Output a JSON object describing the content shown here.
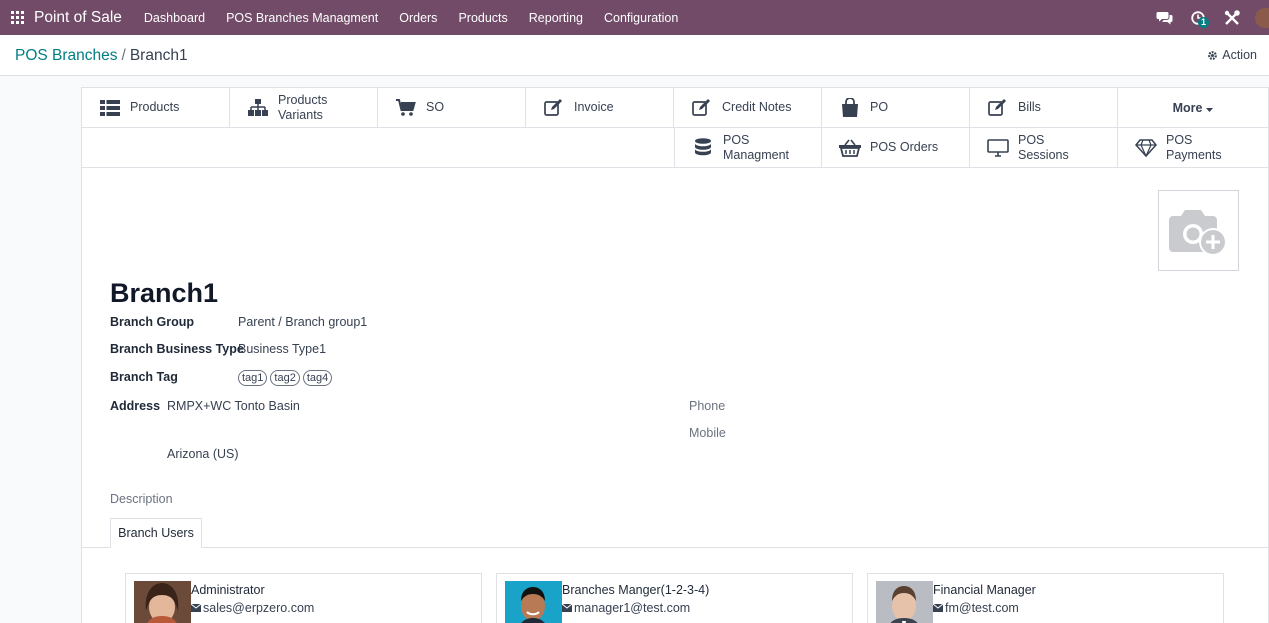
{
  "topnav": {
    "app_name": "Point of Sale",
    "menu": [
      "Dashboard",
      "POS Branches Managment",
      "Orders",
      "Products",
      "Reporting",
      "Configuration"
    ],
    "activity_count": "1",
    "bg_color": "#714b67"
  },
  "breadcrumb": {
    "parent": "POS Branches",
    "separator": "/",
    "current": "Branch1"
  },
  "action_label": "Action",
  "smart_buttons": [
    {
      "label": "Products",
      "icon": "list-icon"
    },
    {
      "label": "Products Variants",
      "icon": "sitemap-icon"
    },
    {
      "label": "SO",
      "icon": "cart-icon"
    },
    {
      "label": "Invoice",
      "icon": "edit-icon"
    },
    {
      "label": "Credit Notes",
      "icon": "edit-icon"
    },
    {
      "label": "PO",
      "icon": "shopping-bag-icon"
    },
    {
      "label": "Bills",
      "icon": "edit-icon"
    },
    {
      "label": "More",
      "icon": "caret-down-icon"
    },
    {
      "label": "POS Managment",
      "icon": "database-icon"
    },
    {
      "label": "POS Orders",
      "icon": "basket-icon"
    },
    {
      "label": "POS Sessions",
      "icon": "desktop-icon"
    },
    {
      "label": "POS Payments",
      "icon": "diamond-icon"
    }
  ],
  "record": {
    "name": "Branch1",
    "branch_group_label": "Branch Group",
    "branch_group": "Parent / Branch group1",
    "business_type_label": "Branch Business Type",
    "business_type": "Business Type1",
    "tag_label": "Branch Tag",
    "tags": [
      "tag1",
      "tag2",
      "tag4"
    ],
    "address_label": "Address",
    "address_line1": "RMPX+WC Tonto Basin",
    "address_line2": "Arizona (US)",
    "phone_label": "Phone",
    "mobile_label": "Mobile",
    "description_label": "Description"
  },
  "tabs": {
    "active": "Branch Users"
  },
  "users": [
    {
      "name": "Administrator",
      "email": "sales@erpzero.com"
    },
    {
      "name": "Branches Manger(1-2-3-4)",
      "email": "manager1@test.com"
    },
    {
      "name": "Financial Manager",
      "email": "fm@test.com"
    }
  ]
}
